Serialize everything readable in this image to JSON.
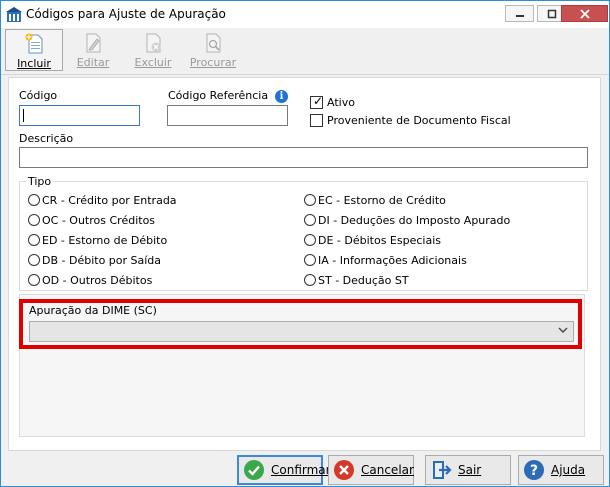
{
  "window": {
    "title": "Códigos para Ajuste de Apuração",
    "minimize_label": "—",
    "maximize_label": "□",
    "close_label": "✕"
  },
  "toolbar": {
    "buttons": [
      {
        "label": "Incluir",
        "icon": "add-document-icon",
        "enabled": true
      },
      {
        "label": "Editar",
        "icon": "edit-document-icon",
        "enabled": false
      },
      {
        "label": "Excluir",
        "icon": "delete-document-icon",
        "enabled": false
      },
      {
        "label": "Procurar",
        "icon": "search-document-icon",
        "enabled": false
      }
    ]
  },
  "form": {
    "codigo_label": "Código",
    "codigo_value": "",
    "codigo_ref_label": "Código Referência",
    "codigo_ref_value": "",
    "info_icon_text": "i",
    "ativo_label": "Ativo",
    "ativo_checked": true,
    "proveniente_label": "Proveniente de Documento Fiscal",
    "proveniente_checked": false,
    "descricao_label": "Descrição",
    "descricao_value": ""
  },
  "tipo": {
    "legend": "Tipo",
    "left_options": [
      "CR - Crédito por Entrada",
      "OC - Outros Créditos",
      "ED - Estorno de Débito",
      "DB - Débito por Saída",
      "OD - Outros Débitos"
    ],
    "right_options": [
      "EC - Estorno de Crédito",
      "DI - Deduções do Imposto Apurado",
      "DE - Débitos Especiais",
      "IA - Informações Adicionais",
      "ST - Dedução ST"
    ]
  },
  "dime": {
    "legend": "Apuração da DIME (SC)",
    "selected_value": ""
  },
  "actions": {
    "confirmar": "Confirmar",
    "cancelar": "Cancelar",
    "sair": "Sair",
    "ajuda": "Ajuda"
  },
  "colors": {
    "highlight": "#e00000",
    "accent": "#3b8ad8"
  }
}
